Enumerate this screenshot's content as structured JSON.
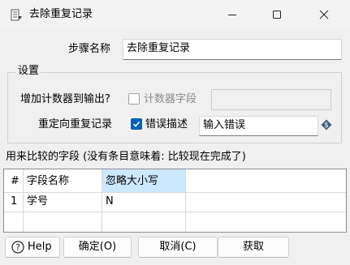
{
  "window": {
    "title": "去除重复记录",
    "icon": "transform-step-icon",
    "controls": [
      "minimize-icon",
      "maximize-icon",
      "close-icon"
    ]
  },
  "step": {
    "name_label": "步骤名称",
    "name_value": "去除重复记录"
  },
  "settings": {
    "group_title": "设置",
    "add_counter_label": "增加计数器到输出?",
    "add_counter_checked": false,
    "counter_field_label": "计数器字段",
    "counter_field_value": "",
    "redirect_label": "重定向重复记录",
    "error_desc_checked": true,
    "error_desc_label": "错误描述",
    "error_desc_value": "输入错误"
  },
  "fields": {
    "caption": "用来比较的字段 (没有条目意味着: 比较现在完成了)",
    "columns": [
      "#",
      "字段名称",
      "忽略大小写"
    ],
    "rows": [
      [
        "1",
        "学号",
        "N"
      ]
    ]
  },
  "buttons": {
    "help": "Help",
    "ok": "确定(O)",
    "cancel": "取消(C)",
    "get": "获取"
  }
}
